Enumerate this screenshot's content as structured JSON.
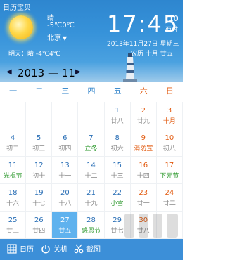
{
  "app_title": "日历宝贝",
  "weather": {
    "condition": "晴",
    "temperature": "-5℃0℃",
    "city": "北京",
    "tomorrow": "明天：晴 -4℃4℃",
    "icon": "sun-icon"
  },
  "clock": {
    "time": "17:45",
    "seconds": ":10",
    "timezone": "西时",
    "date_line": "2013年11月27日  星期三",
    "lunar_line": "农历 十月 廿五"
  },
  "nav": {
    "year_month": "2013 — 11",
    "prev_icon": "triangle-left-icon",
    "next_icon": "triangle-right-icon"
  },
  "weekdays": [
    "一",
    "二",
    "三",
    "四",
    "五",
    "六",
    "日"
  ],
  "weeks": [
    [
      {
        "d": "",
        "s": ""
      },
      {
        "d": "",
        "s": ""
      },
      {
        "d": "",
        "s": ""
      },
      {
        "d": "",
        "s": ""
      },
      {
        "d": "1",
        "s": "廿八"
      },
      {
        "d": "2",
        "s": "廿九"
      },
      {
        "d": "3",
        "s": "十月"
      }
    ],
    [
      {
        "d": "4",
        "s": "初二"
      },
      {
        "d": "5",
        "s": "初三"
      },
      {
        "d": "6",
        "s": "初四"
      },
      {
        "d": "7",
        "s": "立冬"
      },
      {
        "d": "8",
        "s": "初六"
      },
      {
        "d": "9",
        "s": "消防宣"
      },
      {
        "d": "10",
        "s": "初八"
      }
    ],
    [
      {
        "d": "11",
        "s": "光棍节"
      },
      {
        "d": "12",
        "s": "初十"
      },
      {
        "d": "13",
        "s": "十一"
      },
      {
        "d": "14",
        "s": "十二"
      },
      {
        "d": "15",
        "s": "十三"
      },
      {
        "d": "16",
        "s": "十四"
      },
      {
        "d": "17",
        "s": "下元节"
      }
    ],
    [
      {
        "d": "18",
        "s": "十六"
      },
      {
        "d": "19",
        "s": "十七"
      },
      {
        "d": "20",
        "s": "十八"
      },
      {
        "d": "21",
        "s": "十九"
      },
      {
        "d": "22",
        "s": "小雪"
      },
      {
        "d": "23",
        "s": "廿一"
      },
      {
        "d": "24",
        "s": "廿二"
      }
    ],
    [
      {
        "d": "25",
        "s": "廿三"
      },
      {
        "d": "26",
        "s": "廿四"
      },
      {
        "d": "27",
        "s": "廿五"
      },
      {
        "d": "28",
        "s": "感恩节"
      },
      {
        "d": "29",
        "s": "廿七"
      },
      {
        "d": "30",
        "s": "廿八"
      },
      {
        "d": "",
        "s": ""
      }
    ]
  ],
  "today": "27",
  "festival_labels": [
    "光棍节",
    "下元节",
    "立冬",
    "小雪",
    "感恩节"
  ],
  "holiday_labels": [
    "消防宣",
    "十月"
  ],
  "bottom_bar": {
    "calendar_label": "日历",
    "calendar_icon": "calendar-grid-icon",
    "shutdown_label": "关机",
    "shutdown_icon": "power-icon",
    "screenshot_label": "截图",
    "screenshot_icon": "scissors-icon"
  },
  "colors": {
    "header_blue": "#2e86cf",
    "weekday_blue": "#2a7fc8",
    "weekend_orange": "#e25b10",
    "festival_green": "#2f9a2f",
    "today_bg": "#5fb2ee",
    "bottom_bar": "#3c8fd8"
  }
}
